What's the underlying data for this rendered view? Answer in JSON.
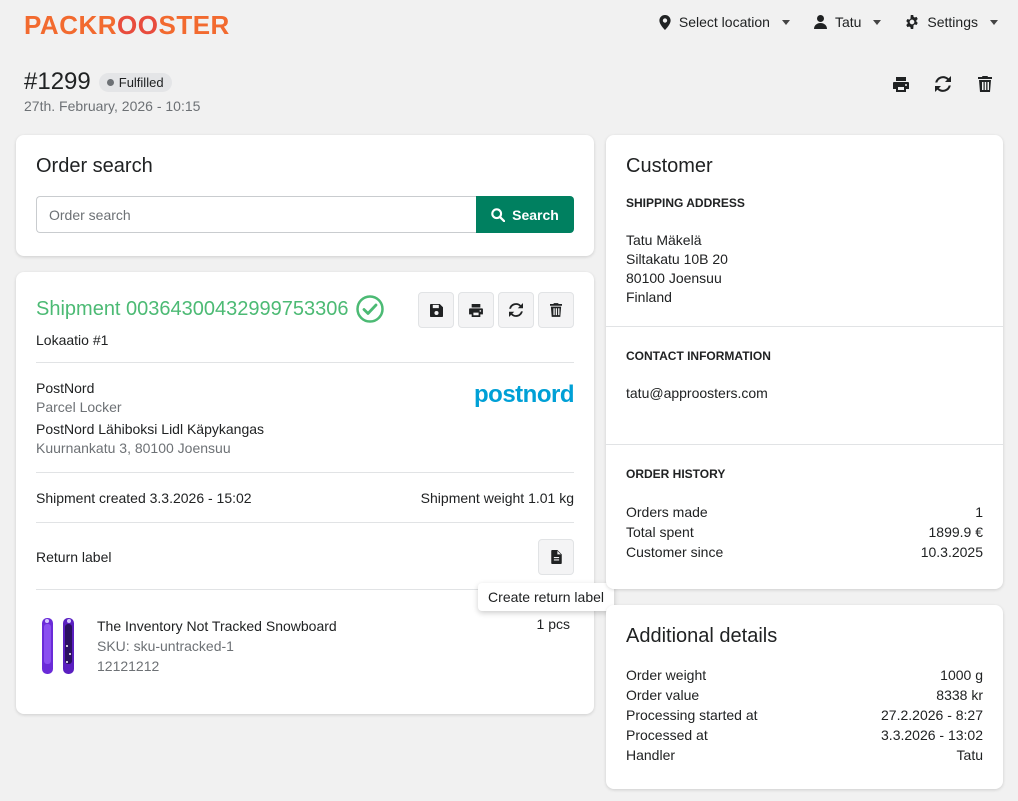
{
  "brand": {
    "logo_text_a": "PACKR",
    "logo_text_b": "OO",
    "logo_text_c": "STER",
    "primary_color": "#008060",
    "success_color": "#4cba74"
  },
  "nav": {
    "location": "Select location",
    "user": "Tatu",
    "settings": "Settings"
  },
  "order": {
    "number": "#1299",
    "status": "Fulfilled",
    "date": "27th. February, 2026 - 10:15"
  },
  "search": {
    "title": "Order search",
    "placeholder": "Order search",
    "button": "Search"
  },
  "shipment": {
    "title": "Shipment 00364300432999753306",
    "location": "Lokaatio #1",
    "carrier": "PostNord",
    "service": "Parcel Locker",
    "pickup_point": "PostNord Lähiboksi Lidl Käpykangas",
    "pickup_address": "Kuurnankatu 3, 80100 Joensuu",
    "carrier_logo": "postnord",
    "created": "Shipment created 3.3.2026 - 15:02",
    "weight": "Shipment weight 1.01 kg",
    "return_label": "Return label",
    "tooltip": "Create return label",
    "product": {
      "name": "The Inventory Not Tracked Snowboard",
      "sku": "SKU: sku-untracked-1",
      "code": "12121212",
      "qty": "1 pcs"
    }
  },
  "customer": {
    "title": "Customer",
    "shipping_label": "SHIPPING ADDRESS",
    "address": [
      "Tatu Mäkelä",
      "Siltakatu 10B 20",
      "80100 Joensuu",
      "Finland"
    ],
    "contact_label": "CONTACT INFORMATION",
    "email": "tatu@approosters.com",
    "history_label": "ORDER HISTORY",
    "history": [
      {
        "k": "Orders made",
        "v": "1"
      },
      {
        "k": "Total spent",
        "v": "1899.9 €"
      },
      {
        "k": "Customer since",
        "v": "10.3.2025"
      }
    ]
  },
  "details": {
    "title": "Additional details",
    "rows": [
      {
        "k": "Order weight",
        "v": "1000 g"
      },
      {
        "k": "Order value",
        "v": "8338 kr"
      },
      {
        "k": "Processing started at",
        "v": "27.2.2026 - 8:27"
      },
      {
        "k": "Processed at",
        "v": "3.3.2026 - 13:02"
      },
      {
        "k": "Handler",
        "v": "Tatu"
      }
    ]
  }
}
